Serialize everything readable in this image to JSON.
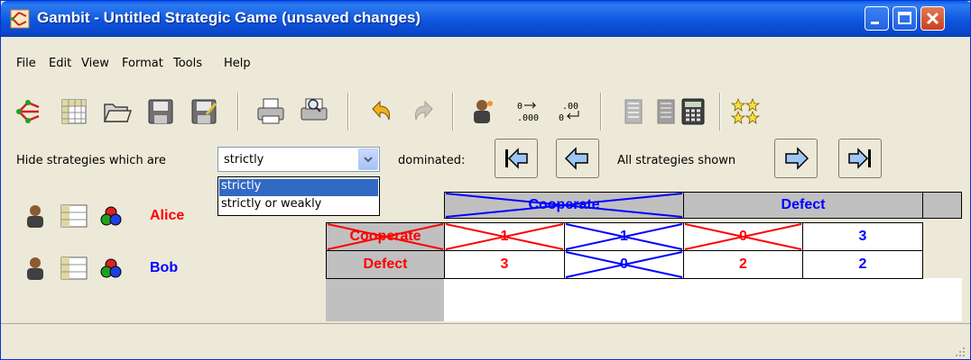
{
  "window": {
    "title": "Gambit - Untitled Strategic Game (unsaved changes)"
  },
  "menubar": {
    "items": [
      "File",
      "Edit",
      "View",
      "Format",
      "Tools",
      "Help"
    ]
  },
  "toolbar": {
    "icons": [
      "gambit-logo-icon",
      "new-table-icon",
      "open-folder-icon",
      "save-disk-icon",
      "save-as-disk-icon",
      "print-icon",
      "print-preview-icon",
      "undo-icon",
      "redo-icon",
      "add-player-icon",
      "increase-decimals-icon",
      "decrease-decimals-icon",
      "dominance-icon",
      "calculator-icon",
      "equilibrium-stars-icon"
    ]
  },
  "dominance": {
    "hide_label": "Hide strategies which are",
    "selected": "strictly",
    "options": [
      "strictly",
      "strictly or weakly"
    ],
    "dominated_label": "dominated:",
    "shown_status": "All strategies shown"
  },
  "players": [
    {
      "name": "Alice",
      "color": "#ff0000"
    },
    {
      "name": "Bob",
      "color": "#0000ff"
    }
  ],
  "game": {
    "column_strategies": [
      "Cooperate",
      "Defect"
    ],
    "row_strategies": [
      "Cooperate",
      "Defect"
    ],
    "payoffs": [
      [
        {
          "alice": "1",
          "bob": "1"
        },
        {
          "alice": "0",
          "bob": "3"
        }
      ],
      [
        {
          "alice": "3",
          "bob": "0"
        },
        {
          "alice": "2",
          "bob": "2"
        }
      ]
    ],
    "eliminated": {
      "column_cooperate": true,
      "row_cooperate": true
    }
  },
  "colors": {
    "alice": "#ff0000",
    "bob": "#0000ff",
    "title_bar": "#0b57e0",
    "selection": "#316ac5"
  }
}
